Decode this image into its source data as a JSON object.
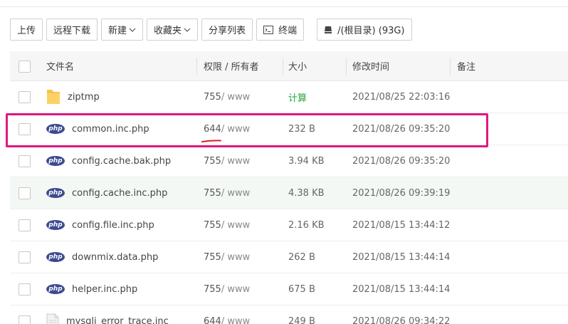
{
  "toolbar": {
    "upload": "上传",
    "remote_download": "远程下载",
    "new": "新建",
    "favorites": "收藏夹",
    "share_list": "分享列表",
    "terminal": "终端",
    "path": "/(根目录) (93G)"
  },
  "table": {
    "headers": {
      "name": "文件名",
      "perm": "权限 / 所有者",
      "size": "大小",
      "time": "修改时间",
      "note": "备注"
    },
    "rows": [
      {
        "name": "ziptmp",
        "perm": "755",
        "owner": " / www",
        "size": "计算",
        "time": "2021/08/25 22:03:16",
        "icon": "folder-icon"
      },
      {
        "name": "common.inc.php",
        "perm": "644",
        "owner": " / www",
        "size": "232 B",
        "time": "2021/08/26 09:35:20",
        "icon": "php-file-icon"
      },
      {
        "name": "config.cache.bak.php",
        "perm": "755",
        "owner": " / www",
        "size": "3.94 KB",
        "time": "2021/08/26 09:35:20",
        "icon": "php-file-icon"
      },
      {
        "name": "config.cache.inc.php",
        "perm": "755",
        "owner": " / www",
        "size": "4.38 KB",
        "time": "2021/08/26 09:39:19",
        "icon": "php-file-icon"
      },
      {
        "name": "config.file.inc.php",
        "perm": "755",
        "owner": " / www",
        "size": "2.16 KB",
        "time": "2021/08/15 13:44:12",
        "icon": "php-file-icon"
      },
      {
        "name": "downmix.data.php",
        "perm": "755",
        "owner": " / www",
        "size": "262 B",
        "time": "2021/08/15 13:44:14",
        "icon": "php-file-icon"
      },
      {
        "name": "helper.inc.php",
        "perm": "755",
        "owner": " / www",
        "size": "675 B",
        "time": "2021/08/15 13:44:14",
        "icon": "php-file-icon"
      },
      {
        "name": "mysqli_error_trace.inc",
        "perm": "644",
        "owner": " / www",
        "size": "249 B",
        "time": "2021/08/26 09:34:22",
        "icon": "file-icon"
      }
    ]
  },
  "php_badge": "php",
  "colors": {
    "highlight": "#e0197f",
    "calc": "#20a53a",
    "php_badge": "#3d4a8f"
  }
}
